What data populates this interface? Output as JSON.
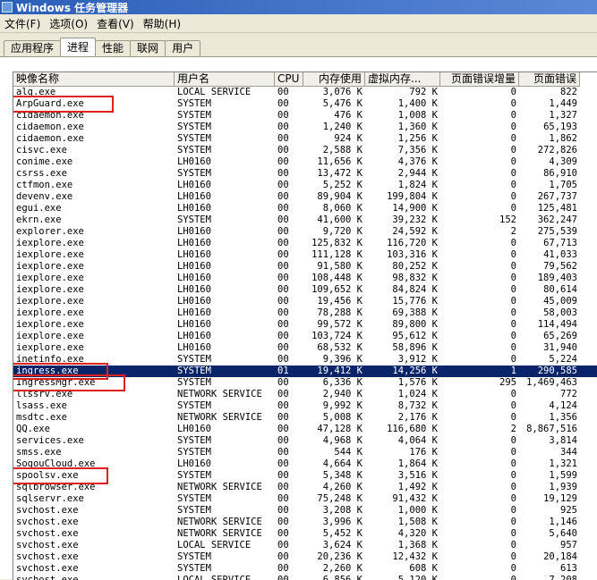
{
  "window": {
    "title": "Windows 任务管理器"
  },
  "menu": [
    "文件(F)",
    "选项(O)",
    "查看(V)",
    "帮助(H)"
  ],
  "tabs": [
    "应用程序",
    "进程",
    "性能",
    "联网",
    "用户"
  ],
  "active_tab": 1,
  "columns": [
    "映像名称",
    "用户名",
    "CPU",
    "内存使用",
    "虚拟内存...",
    "页面错误增量",
    "页面错误"
  ],
  "processes": [
    [
      "alg.exe",
      "LOCAL SERVICE",
      "00",
      "3,076 K",
      "792 K",
      "0",
      "822"
    ],
    [
      "ArpGuard.exe",
      "SYSTEM",
      "00",
      "5,476 K",
      "1,400 K",
      "0",
      "1,449"
    ],
    [
      "cidaemon.exe",
      "SYSTEM",
      "00",
      "476 K",
      "1,008 K",
      "0",
      "1,327"
    ],
    [
      "cidaemon.exe",
      "SYSTEM",
      "00",
      "1,240 K",
      "1,360 K",
      "0",
      "65,193"
    ],
    [
      "cidaemon.exe",
      "SYSTEM",
      "00",
      "924 K",
      "1,256 K",
      "0",
      "1,862"
    ],
    [
      "cisvc.exe",
      "SYSTEM",
      "00",
      "2,588 K",
      "7,356 K",
      "0",
      "272,826"
    ],
    [
      "conime.exe",
      "LH0160",
      "00",
      "11,656 K",
      "4,376 K",
      "0",
      "4,309"
    ],
    [
      "csrss.exe",
      "SYSTEM",
      "00",
      "13,472 K",
      "2,944 K",
      "0",
      "86,910"
    ],
    [
      "ctfmon.exe",
      "LH0160",
      "00",
      "5,252 K",
      "1,824 K",
      "0",
      "1,705"
    ],
    [
      "devenv.exe",
      "LH0160",
      "00",
      "89,904 K",
      "199,804 K",
      "0",
      "267,737"
    ],
    [
      "egui.exe",
      "LH0160",
      "00",
      "8,060 K",
      "14,900 K",
      "0",
      "125,481"
    ],
    [
      "ekrn.exe",
      "SYSTEM",
      "00",
      "41,600 K",
      "39,232 K",
      "152",
      "362,247"
    ],
    [
      "explorer.exe",
      "LH0160",
      "00",
      "9,720 K",
      "24,592 K",
      "2",
      "275,539"
    ],
    [
      "iexplore.exe",
      "LH0160",
      "00",
      "125,832 K",
      "116,720 K",
      "0",
      "67,713"
    ],
    [
      "iexplore.exe",
      "LH0160",
      "00",
      "111,128 K",
      "103,316 K",
      "0",
      "41,033"
    ],
    [
      "iexplore.exe",
      "LH0160",
      "00",
      "91,580 K",
      "80,252 K",
      "0",
      "79,562"
    ],
    [
      "iexplore.exe",
      "LH0160",
      "00",
      "108,448 K",
      "98,832 K",
      "0",
      "189,403"
    ],
    [
      "iexplore.exe",
      "LH0160",
      "00",
      "109,652 K",
      "84,824 K",
      "0",
      "80,614"
    ],
    [
      "iexplore.exe",
      "LH0160",
      "00",
      "19,456 K",
      "15,776 K",
      "0",
      "45,009"
    ],
    [
      "iexplore.exe",
      "LH0160",
      "00",
      "78,288 K",
      "69,388 K",
      "0",
      "58,003"
    ],
    [
      "iexplore.exe",
      "LH0160",
      "00",
      "99,572 K",
      "89,800 K",
      "0",
      "114,494"
    ],
    [
      "iexplore.exe",
      "LH0160",
      "00",
      "103,724 K",
      "95,612 K",
      "0",
      "65,269"
    ],
    [
      "iexplore.exe",
      "LH0160",
      "00",
      "68,532 K",
      "58,896 K",
      "0",
      "31,940"
    ],
    [
      "inetinfo.exe",
      "SYSTEM",
      "00",
      "9,396 K",
      "3,912 K",
      "0",
      "5,224"
    ],
    [
      "ingress.exe",
      "SYSTEM",
      "01",
      "19,412 K",
      "14,256 K",
      "1",
      "290,585"
    ],
    [
      "IngressMgr.exe",
      "SYSTEM",
      "00",
      "6,336 K",
      "1,576 K",
      "295",
      "1,469,463"
    ],
    [
      "llssrv.exe",
      "NETWORK SERVICE",
      "00",
      "2,940 K",
      "1,024 K",
      "0",
      "772"
    ],
    [
      "lsass.exe",
      "SYSTEM",
      "00",
      "9,992 K",
      "8,732 K",
      "0",
      "4,124"
    ],
    [
      "msdtc.exe",
      "NETWORK SERVICE",
      "00",
      "5,008 K",
      "2,176 K",
      "0",
      "1,356"
    ],
    [
      "QQ.exe",
      "LH0160",
      "00",
      "47,128 K",
      "116,680 K",
      "2",
      "8,867,516"
    ],
    [
      "services.exe",
      "SYSTEM",
      "00",
      "4,968 K",
      "4,064 K",
      "0",
      "3,814"
    ],
    [
      "smss.exe",
      "SYSTEM",
      "00",
      "544 K",
      "176 K",
      "0",
      "344"
    ],
    [
      "SogouCloud.exe",
      "LH0160",
      "00",
      "4,664 K",
      "1,864 K",
      "0",
      "1,321"
    ],
    [
      "spoolsv.exe",
      "SYSTEM",
      "00",
      "5,348 K",
      "3,516 K",
      "0",
      "1,599"
    ],
    [
      "sqlbrowser.exe",
      "NETWORK SERVICE",
      "00",
      "4,260 K",
      "1,492 K",
      "0",
      "1,939"
    ],
    [
      "sqlservr.exe",
      "SYSTEM",
      "00",
      "75,248 K",
      "91,432 K",
      "0",
      "19,129"
    ],
    [
      "svchost.exe",
      "SYSTEM",
      "00",
      "3,208 K",
      "1,000 K",
      "0",
      "925"
    ],
    [
      "svchost.exe",
      "NETWORK SERVICE",
      "00",
      "3,996 K",
      "1,508 K",
      "0",
      "1,146"
    ],
    [
      "svchost.exe",
      "NETWORK SERVICE",
      "00",
      "5,452 K",
      "4,320 K",
      "0",
      "5,640"
    ],
    [
      "svchost.exe",
      "LOCAL SERVICE",
      "00",
      "3,624 K",
      "1,368 K",
      "0",
      "957"
    ],
    [
      "svchost.exe",
      "SYSTEM",
      "00",
      "20,236 K",
      "12,432 K",
      "0",
      "20,184"
    ],
    [
      "svchost.exe",
      "SYSTEM",
      "00",
      "2,260 K",
      "608 K",
      "0",
      "613"
    ],
    [
      "svchost.exe",
      "LOCAL SERVICE",
      "00",
      "6,856 K",
      "5,120 K",
      "0",
      "7,208"
    ]
  ],
  "selected_row": 24,
  "highlighted_rows": [
    1,
    24,
    25,
    33
  ],
  "colors": {
    "highlight_box": "#e0201c",
    "selection": "#0a246a",
    "title_bar": "#2a5fb8"
  }
}
